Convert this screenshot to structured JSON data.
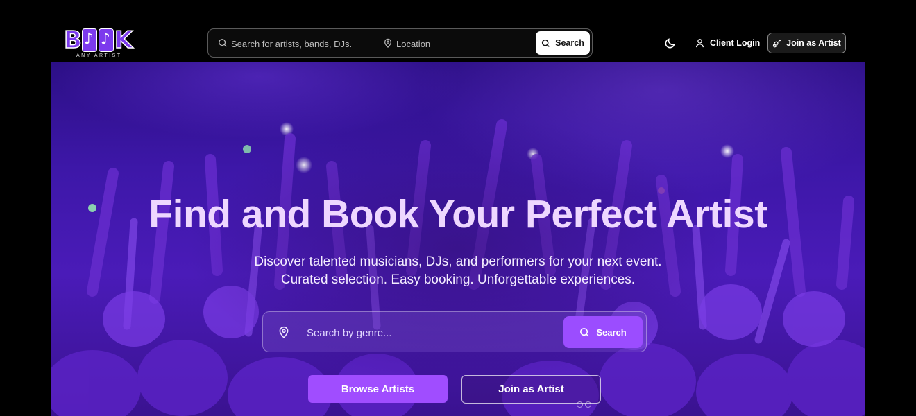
{
  "brand": {
    "logo_letters": [
      "B",
      "K"
    ],
    "tagline": "ANY ARTIST",
    "accent": "#7c3aed"
  },
  "header": {
    "search": {
      "query_placeholder": "Search for artists, bands, DJs.",
      "location_placeholder": "Location",
      "button_label": "Search",
      "search_icon": "search-icon",
      "location_icon": "map-pin-icon"
    },
    "theme_icon": "moon-icon",
    "client_login_label": "Client Login",
    "client_login_icon": "user-icon",
    "join_label": "Join as Artist",
    "join_icon": "guitar-icon"
  },
  "hero": {
    "title": "Find and Book Your Perfect Artist",
    "subtitle_line1": "Discover talented musicians, DJs, and performers for your next event.",
    "subtitle_line2": "Curated selection. Easy booking. Unforgettable experiences.",
    "genre_search": {
      "placeholder": "Search by genre...",
      "button_label": "Search",
      "pin_icon": "map-pin-icon",
      "search_icon": "search-icon"
    },
    "browse_label": "Browse Artists",
    "join_label": "Join as Artist",
    "primary_color": "#a04dff"
  }
}
